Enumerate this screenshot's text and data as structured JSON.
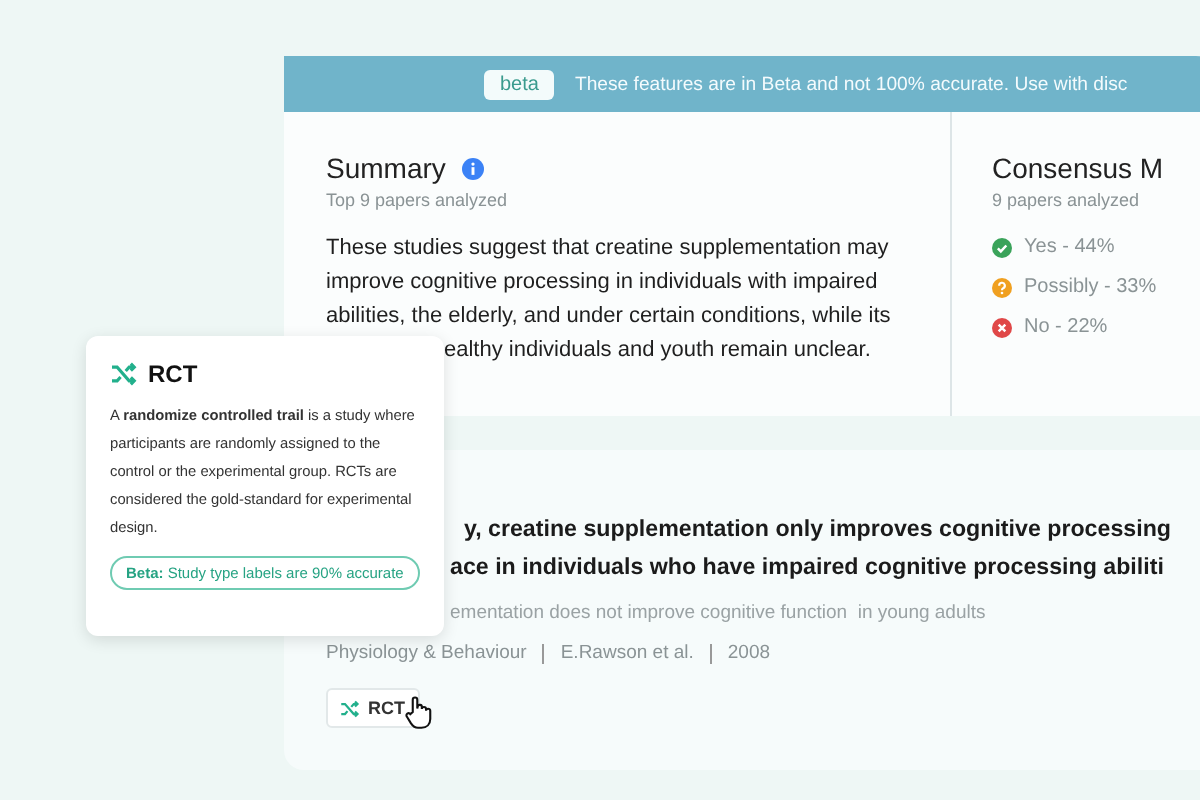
{
  "banner": {
    "badge": "beta",
    "text": "These features are in Beta and not 100% accurate. Use with disc"
  },
  "summary": {
    "title": "Summary",
    "subtitle": "Top 9 papers analyzed",
    "lines": [
      {
        "text": "These studies suggest that creatine supplementation may",
        "partial": false
      },
      {
        "text": "improve cognitive processing in individuals with impaired",
        "partial": false
      },
      {
        "text": "abilities, the elderly, and under certain conditions, while its",
        "partial": false
      },
      {
        "text": "ealthy individuals and youth remain unclear.",
        "partial": true
      }
    ]
  },
  "consensus": {
    "title": "Consensus M",
    "subtitle": "9 papers analyzed",
    "answers": [
      {
        "kind": "yes",
        "label": "Yes - 44%",
        "color": "#3aa35a"
      },
      {
        "kind": "possibly",
        "label": "Possibly - 33%",
        "color": "#f0a020"
      },
      {
        "kind": "no",
        "label": "No - 22%",
        "color": "#e04848"
      }
    ]
  },
  "paper": {
    "title_lines": [
      "y, creatine supplementation only improves cognitive processing",
      "ace in individuals who have impaired cognitive processing abiliti"
    ],
    "finding": "ementation does not improve cognitive function  in young adults",
    "journal": "Physiology & Behaviour",
    "authors": "E.Rawson et al.",
    "year": "2008",
    "tag": "RCT"
  },
  "tooltip": {
    "title": "RCT",
    "body": "A **randomize controlled trail** is a study where participants are randomly assigned to the control or the experimental group. RCTs are considered the gold-standard for experimental design.",
    "note": "**Beta:** Study type labels are 90% accurate"
  }
}
